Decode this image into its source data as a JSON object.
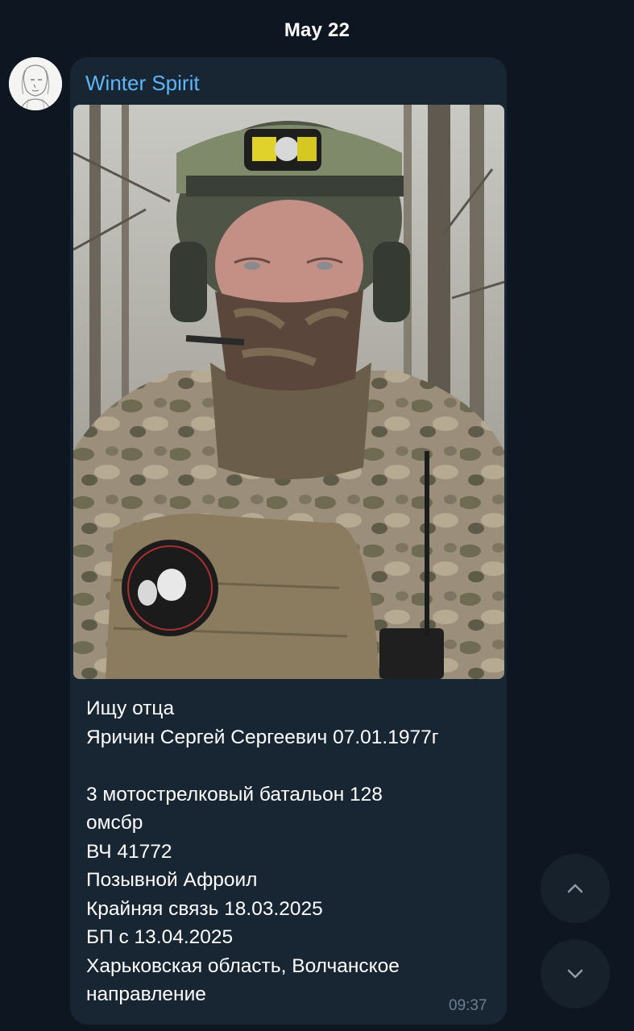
{
  "chat": {
    "date_separator": "May 22"
  },
  "message": {
    "sender_name": "Winter Spirit",
    "photo_icon": "selfie-photo",
    "lines": [
      "Ищу отца",
      "Яричин Сергей Сергеевич 07.01.1977г",
      "",
      "3 мотострелковый батальон 128",
      "омсбр",
      "ВЧ 41772",
      "Позывной Афроил",
      "Крайняя связь 18.03.2025",
      "БП с 13.04.2025",
      "Харьковская область, Волчанское",
      "направление"
    ],
    "time": "09:37"
  },
  "controls": {
    "scroll_up_icon": "chevron-up-icon",
    "scroll_down_icon": "chevron-down-icon"
  },
  "colors": {
    "background": "#0e1621",
    "bubble": "#182533",
    "sender": "#5eb5f7",
    "time": "#6d7f8f",
    "fab": "#17212b"
  }
}
